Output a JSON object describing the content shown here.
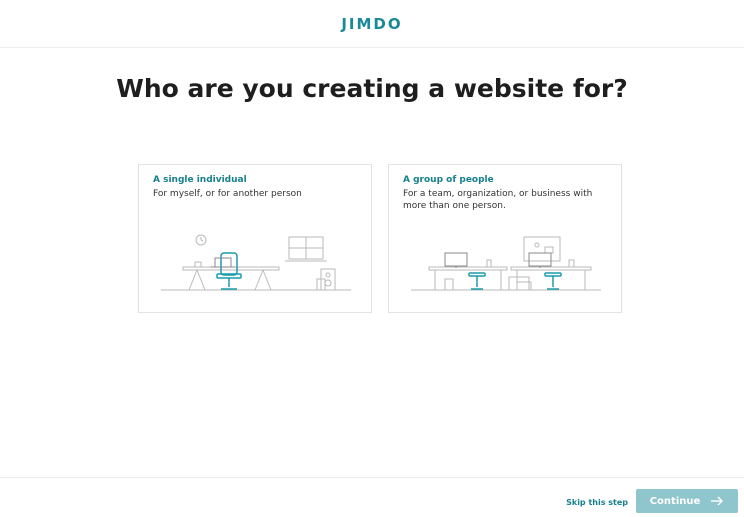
{
  "header": {
    "logo_text": "JIMDO"
  },
  "main": {
    "title": "Who are you creating a website for?",
    "options": [
      {
        "title": "A single individual",
        "description": "For myself, or for another person",
        "illustration_icon": "desk-single-person-illustration"
      },
      {
        "title": "A group of people",
        "description": "For a team, organization, or business with more than one person.",
        "illustration_icon": "desks-group-illustration"
      }
    ]
  },
  "footer": {
    "skip_label": "Skip this step",
    "continue_label": "Continue",
    "continue_icon": "arrow-right-icon"
  },
  "colors": {
    "accent": "#16808d",
    "button_disabled": "#8fc6cd",
    "illustration_line": "#b9b9b9"
  }
}
